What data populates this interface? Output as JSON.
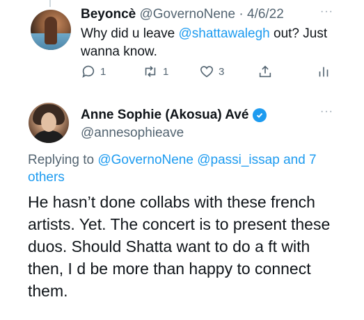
{
  "tweet1": {
    "author_name": "Beyoncè",
    "handle": "@GovernoNene",
    "separator": "·",
    "date": "4/6/22",
    "text_before": "Why did u leave ",
    "mention": "@shattawalegh",
    "text_after": " out? Just wanna know.",
    "reply_count": "1",
    "retweet_count": "1",
    "like_count": "3",
    "more_glyph": "···"
  },
  "tweet2": {
    "author_name": "Anne Sophie (Akosua) Avé",
    "handle": "@annesophieave",
    "more_glyph": "···",
    "replying_prefix": "Replying to ",
    "replying_mention1": "@GovernoNene",
    "replying_mention2": "@passi_issap",
    "replying_suffix": " and 7 others",
    "text": "He hasn’t done collabs with these french artists. Yet. The concert is to present these duos. Should Shatta want to do a ft with then, I d be more than happy to connect them."
  },
  "colors": {
    "accent": "#1d9bf0",
    "muted": "#536471",
    "text": "#0f1419"
  },
  "icons": {
    "reply": "speech-bubble-icon",
    "retweet": "retweet-icon",
    "like": "heart-icon",
    "share": "share-icon",
    "analytics": "analytics-icon",
    "verified": "verified-badge-icon",
    "more": "more-dots-icon"
  }
}
